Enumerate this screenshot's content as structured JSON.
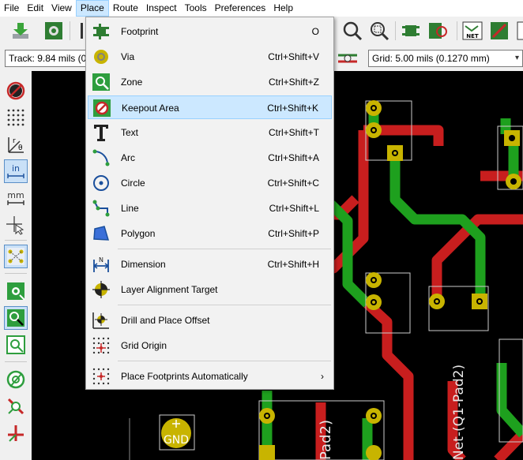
{
  "menubar": {
    "items": [
      "File",
      "Edit",
      "View",
      "Place",
      "Route",
      "Inspect",
      "Tools",
      "Preferences",
      "Help"
    ],
    "active": "Place"
  },
  "toolbar2": {
    "track": "Track: 9.84 mils (0.",
    "grid": "Grid: 5.00 mils (0.1270 mm)"
  },
  "place_menu": {
    "items": [
      {
        "label": "Footprint",
        "shortcut": "O",
        "icon": "footprint-icon"
      },
      {
        "label": "Via",
        "shortcut": "Ctrl+Shift+V",
        "icon": "via-icon"
      },
      {
        "label": "Zone",
        "shortcut": "Ctrl+Shift+Z",
        "icon": "zone-icon"
      },
      {
        "label": "Keepout Area",
        "shortcut": "Ctrl+Shift+K",
        "icon": "keepout-icon",
        "highlighted": true
      },
      {
        "label": "Text",
        "shortcut": "Ctrl+Shift+T",
        "icon": "text-icon"
      },
      {
        "label": "Arc",
        "shortcut": "Ctrl+Shift+A",
        "icon": "arc-icon"
      },
      {
        "label": "Circle",
        "shortcut": "Ctrl+Shift+C",
        "icon": "circle-icon"
      },
      {
        "label": "Line",
        "shortcut": "Ctrl+Shift+L",
        "icon": "line-icon"
      },
      {
        "label": "Polygon",
        "shortcut": "Ctrl+Shift+P",
        "icon": "polygon-icon"
      },
      {
        "label": "Dimension",
        "shortcut": "Ctrl+Shift+H",
        "icon": "dimension-icon"
      },
      {
        "label": "Layer Alignment Target",
        "shortcut": "",
        "icon": "alignment-target-icon"
      },
      {
        "label": "Drill and Place Offset",
        "shortcut": "",
        "icon": "drill-offset-icon"
      },
      {
        "label": "Grid Origin",
        "shortcut": "",
        "icon": "grid-origin-icon"
      },
      {
        "label": "Place Footprints Automatically",
        "shortcut": "",
        "icon": "autoplace-icon",
        "submenu": "›"
      }
    ]
  },
  "canvas": {
    "gnd_label": "GND",
    "net_label": "Net-(Q1-Pad2)",
    "pad2_label": "Pad2)",
    "colors": {
      "background": "#000000",
      "front_copper": "#c81e1e",
      "back_copper": "#1ea01e",
      "pad": "#c8b400"
    }
  },
  "colors": {
    "menu_highlight": "#cce8ff",
    "menu_highlight_border": "#99d1ff"
  }
}
